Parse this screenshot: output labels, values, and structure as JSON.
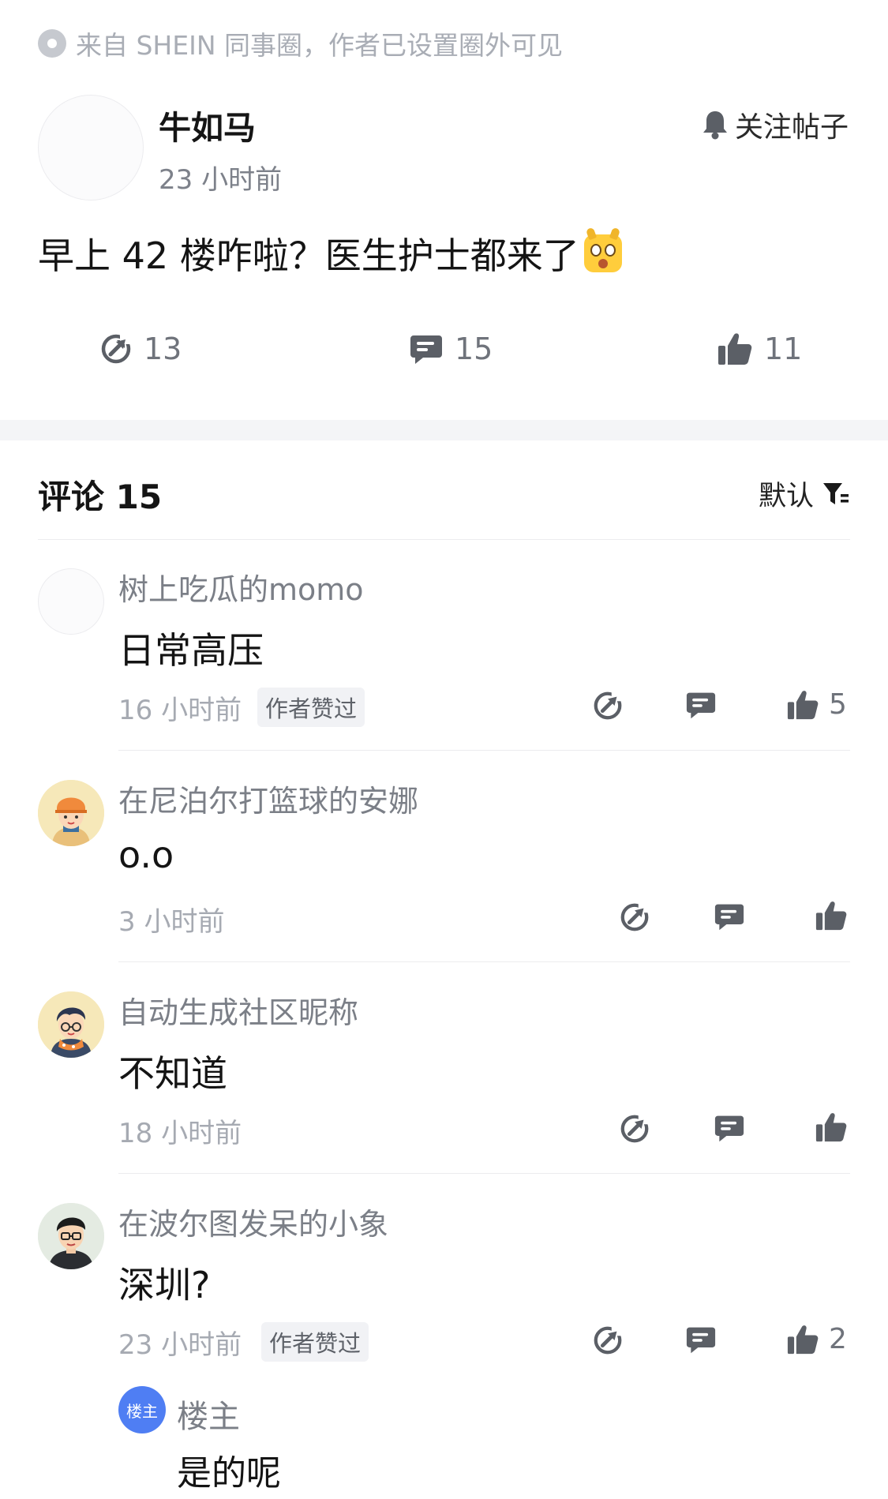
{
  "source_notice": "来自 SHEIN 同事圈，作者已设置圈外可见",
  "post": {
    "author": "牛如马",
    "time": "23 小时前",
    "follow_label": "关注帖子",
    "text": "早上 42 楼咋啦？医生护士都来了",
    "emoji": "astonished-face-emoji",
    "stats": {
      "share": "13",
      "comments": "15",
      "likes": "11"
    }
  },
  "comments_header": {
    "title": "评论 15",
    "sort_label": "默认"
  },
  "comments": [
    {
      "name": "树上吃瓜的momo",
      "text": "日常高压",
      "time": "16 小时前",
      "badge": "作者赞过",
      "likes": "5",
      "avatar": "blank-avatar"
    },
    {
      "name": "在尼泊尔打篮球的安娜",
      "text": "o.o",
      "time": "3 小时前",
      "badge": "",
      "likes": "",
      "avatar": "girl-orange-hat-avatar"
    },
    {
      "name": "自动生成社区昵称",
      "text": "不知道",
      "time": "18 小时前",
      "badge": "",
      "likes": "",
      "avatar": "boy-glasses-scarf-avatar"
    },
    {
      "name": "在波尔图发呆的小象",
      "text": "深圳?",
      "time": "23 小时前",
      "badge": "作者赞过",
      "likes": "2",
      "avatar": "man-glasses-avatar"
    }
  ],
  "reply": {
    "badge": "楼主",
    "name": "楼主",
    "text": "是的呢"
  },
  "colors": {
    "accent_blue": "#4f7ef3",
    "icon_gray": "#5b5f66",
    "divider": "#f4f5f7"
  }
}
